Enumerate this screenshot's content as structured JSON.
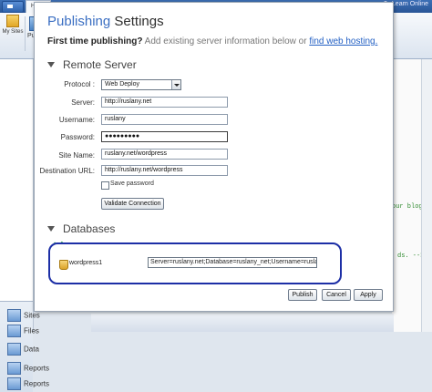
{
  "app": {
    "home_tab": "Home",
    "help_text": "Learn Online",
    "my_sites_label": "My Sites",
    "publish_partial": "Pub",
    "left_items": [
      "Sites",
      "Files",
      "Data",
      "Reports",
      "Reports"
    ],
    "code_snippets": [
      "our blog is",
      "ds. -->"
    ]
  },
  "dialog": {
    "title_accent": "Publishing",
    "title_rest": " Settings",
    "intro_bold": "First time publishing?",
    "intro_text": " Add existing server information below or ",
    "intro_link": "find web hosting."
  },
  "remote_server": {
    "heading": "Remote Server",
    "fields": {
      "protocol": {
        "label": "Protocol :",
        "value": "Web Deploy"
      },
      "server": {
        "label": "Server:",
        "value": "http://ruslany.net"
      },
      "username": {
        "label": "Username:",
        "value": "ruslany"
      },
      "password": {
        "label": "Password:",
        "value": "●●●●●●●●●"
      },
      "site_name": {
        "label": "Site Name:",
        "value": "ruslany.net/wordpress"
      },
      "destination_url": {
        "label": "Destination URL:",
        "value": "http://ruslany.net/wordpress"
      }
    },
    "save_password_label": "Save password",
    "save_password_checked": false,
    "validate_button": "Validate Connection"
  },
  "databases": {
    "heading": "Databases",
    "items": [
      {
        "name": "wordpress1",
        "connection_string": "Server=ruslany.net;Database=ruslany_net;Username=ruslany;Password"
      }
    ]
  },
  "buttons": {
    "publish": "Publish",
    "cancel": "Cancel",
    "apply": "Apply"
  },
  "colors": {
    "title_accent": "#3a6ec2",
    "link": "#2360c4",
    "highlight_outline": "#1d2fa6"
  }
}
